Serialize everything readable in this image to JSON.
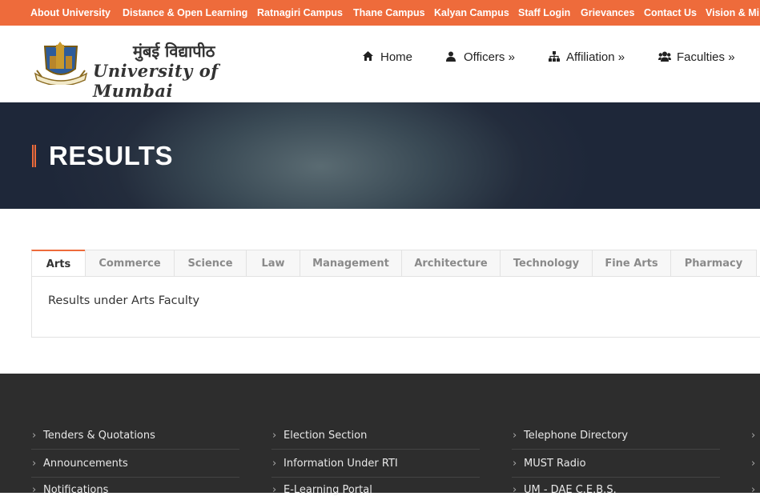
{
  "topbar": {
    "links": [
      "About University",
      "Distance & Open Learning",
      "Ratnagiri Campus",
      "Thane Campus",
      "Kalyan Campus",
      "Staff Login",
      "Grievances",
      "Contact Us",
      "Vision & Mi"
    ]
  },
  "logo": {
    "hindi": "मुंबई विद्यापीठ",
    "english": "University of Mumbai"
  },
  "nav": {
    "items": [
      {
        "label": "Home",
        "icon": "home-icon"
      },
      {
        "label": "Officers »",
        "icon": "user-icon"
      },
      {
        "label": "Affiliation »",
        "icon": "sitemap-icon"
      },
      {
        "label": "Faculties »",
        "icon": "users-icon"
      }
    ]
  },
  "banner": {
    "title": "RESULTS"
  },
  "tabs": {
    "items": [
      "Arts",
      "Commerce",
      "Science",
      "Law",
      "Management",
      "Architecture",
      "Technology",
      "Fine Arts",
      "Pharmacy"
    ],
    "active": "Arts",
    "panel_text": "Results under Arts Faculty"
  },
  "footer": {
    "col1": [
      "Tenders & Quotations",
      "Announcements",
      "Notifications"
    ],
    "col2": [
      "Election Section",
      "Information Under RTI",
      "E-Learning Portal"
    ],
    "col3": [
      "Telephone Directory",
      "MUST Radio",
      "UM - DAE C.E.B.S."
    ]
  },
  "colors": {
    "accent": "#ee6b3b",
    "footer_bg": "#2d2d2d"
  }
}
